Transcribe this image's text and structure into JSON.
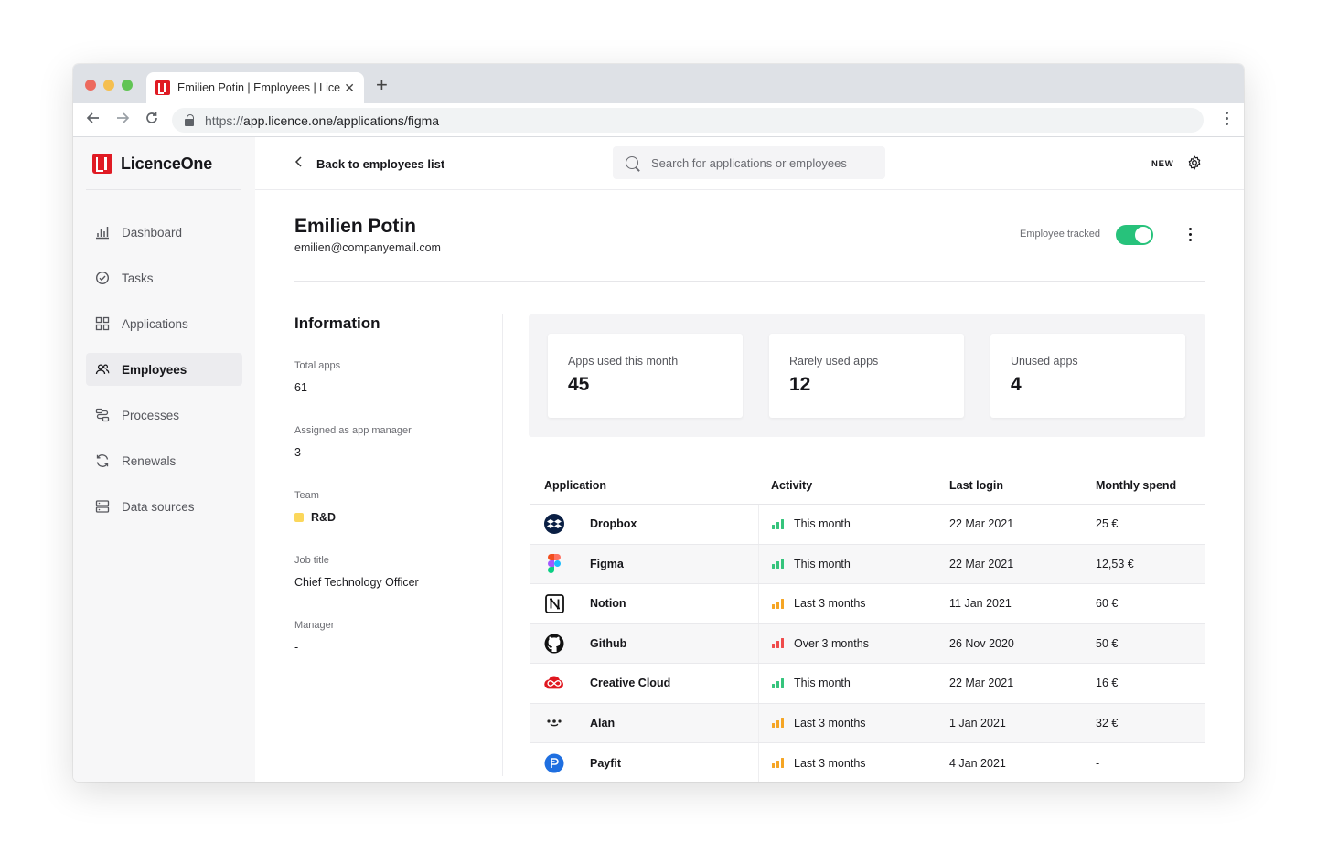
{
  "browser": {
    "tab_title": "Emilien Potin | Employees | Licence",
    "tab_close": "✕",
    "new_tab": "+",
    "url_protocol": "https://",
    "url_rest": "app.licence.one/applications/figma"
  },
  "brand": {
    "name": "LicenceOne",
    "accent": "#e01b24"
  },
  "sidebar": {
    "items": [
      {
        "label": "Dashboard",
        "icon": "bar-chart-icon"
      },
      {
        "label": "Tasks",
        "icon": "check-circle-icon"
      },
      {
        "label": "Applications",
        "icon": "grid-icon"
      },
      {
        "label": "Employees",
        "icon": "users-icon",
        "active": true
      },
      {
        "label": "Processes",
        "icon": "process-icon"
      },
      {
        "label": "Renewals",
        "icon": "refresh-icon"
      },
      {
        "label": "Data sources",
        "icon": "database-icon"
      }
    ]
  },
  "topbar": {
    "back_label": "Back to employees list",
    "search_placeholder": "Search for applications or employees",
    "new_label": "NEW"
  },
  "profile": {
    "name": "Emilien Potin",
    "email": "emilien@companyemail.com",
    "tracked_label": "Employee tracked",
    "tracked": true,
    "toggle_color": "#27c27b"
  },
  "information": {
    "title": "Information",
    "fields": [
      {
        "label": "Total apps",
        "value": "61"
      },
      {
        "label": "Assigned as app manager",
        "value": "3"
      },
      {
        "label": "Team",
        "value": "R&D",
        "chip_color": "#fbd75b"
      },
      {
        "label": "Job title",
        "value": "Chief Technology Officer"
      },
      {
        "label": "Manager",
        "value": "-"
      }
    ]
  },
  "stats": [
    {
      "label": "Apps used this month",
      "value": "45"
    },
    {
      "label": "Rarely used apps",
      "value": "12"
    },
    {
      "label": "Unused apps",
      "value": "4"
    }
  ],
  "table": {
    "columns": [
      "Application",
      "Activity",
      "Last login",
      "Monthly spend"
    ],
    "rows": [
      {
        "app": "Dropbox",
        "icon": "dropbox-icon",
        "activity": "This month",
        "activity_color": "#35c47c",
        "last_login": "22 Mar 2021",
        "spend": "25 €"
      },
      {
        "app": "Figma",
        "icon": "figma-icon",
        "activity": "This month",
        "activity_color": "#35c47c",
        "last_login": "22 Mar 2021",
        "spend": "12,53 €"
      },
      {
        "app": "Notion",
        "icon": "notion-icon",
        "activity": "Last 3 months",
        "activity_color": "#f5a524",
        "last_login": "11 Jan 2021",
        "spend": "60 €"
      },
      {
        "app": "Github",
        "icon": "github-icon",
        "activity": "Over 3 months",
        "activity_color": "#ef4b4b",
        "last_login": "26 Nov 2020",
        "spend": "50 €"
      },
      {
        "app": "Creative Cloud",
        "icon": "creative-cloud-icon",
        "activity": "This month",
        "activity_color": "#35c47c",
        "last_login": "22 Mar 2021",
        "spend": "16 €"
      },
      {
        "app": "Alan",
        "icon": "alan-icon",
        "activity": "Last 3 months",
        "activity_color": "#f5a524",
        "last_login": "1 Jan 2021",
        "spend": "32 €"
      },
      {
        "app": "Payfit",
        "icon": "payfit-icon",
        "activity": "Last 3 months",
        "activity_color": "#f5a524",
        "last_login": "4 Jan 2021",
        "spend": "-"
      }
    ]
  }
}
